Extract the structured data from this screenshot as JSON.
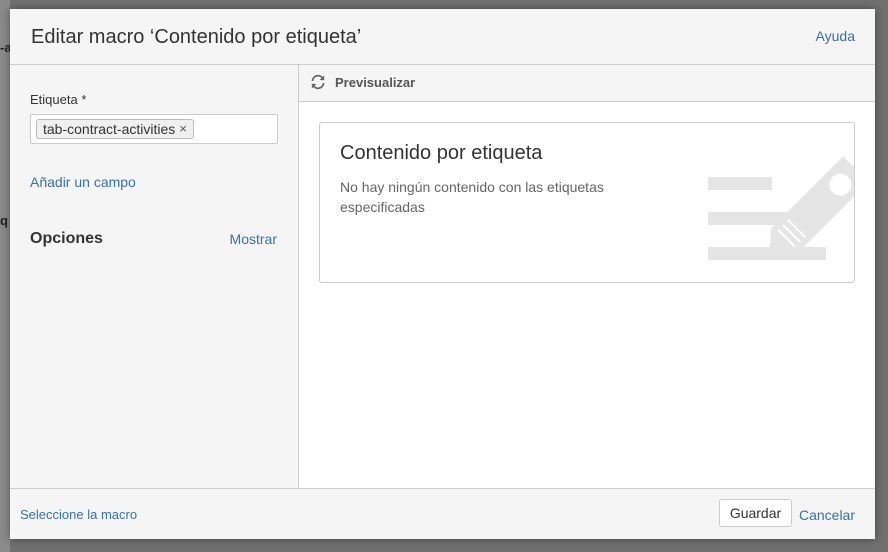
{
  "dialog": {
    "title": "Editar macro ‘Contenido por etiqueta’",
    "help_label": "Ayuda"
  },
  "form": {
    "label_field": "Etiqueta *",
    "tags": [
      "tab-contract-activities"
    ],
    "remove_tag_glyph": "×",
    "add_field_label": "Añadir un campo",
    "options_title": "Opciones",
    "show_label": "Mostrar"
  },
  "preview": {
    "label": "Previsualizar",
    "card_title": "Contenido por etiqueta",
    "card_message": "No hay ningún contenido con las etiquetas especificadas"
  },
  "footer": {
    "select_macro_label": "Seleccione la macro",
    "save_label": "Guardar",
    "cancel_label": "Cancelar"
  },
  "icons": {
    "refresh": "refresh-icon",
    "illustration": "tag-illustration-icon"
  },
  "colors": {
    "link": "#3572b0",
    "panel_bg": "#f5f5f5",
    "overlay": "#707070",
    "illustration": "#e5e5e5"
  }
}
